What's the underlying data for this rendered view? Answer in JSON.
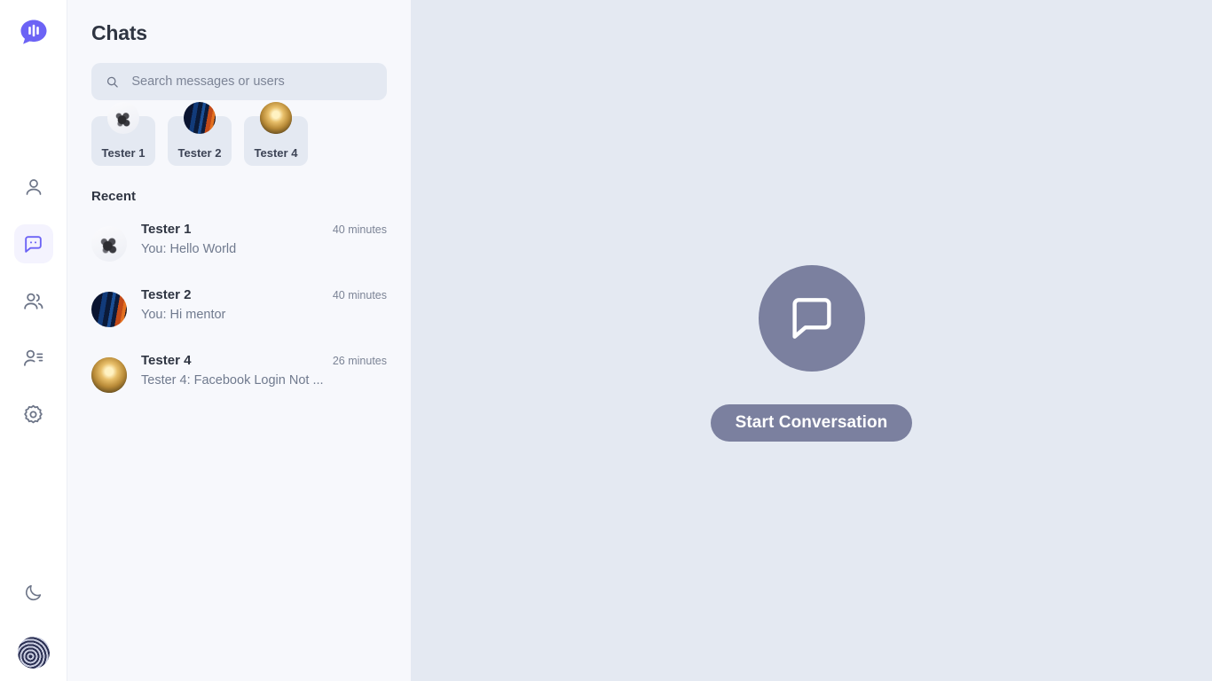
{
  "rail": {
    "logo": {
      "name": "app-logo",
      "icon": "chat-bubble-logo-icon",
      "color": "#6c63f5"
    },
    "items": [
      {
        "id": "profile",
        "icon": "user-icon",
        "active": false
      },
      {
        "id": "chats",
        "icon": "chat-bubble-icon",
        "active": true
      },
      {
        "id": "groups",
        "icon": "users-group-icon",
        "active": false
      },
      {
        "id": "contacts",
        "icon": "user-list-icon",
        "active": false
      },
      {
        "id": "settings",
        "icon": "gear-icon",
        "active": false
      }
    ],
    "theme_toggle": {
      "icon": "moon-icon"
    },
    "account_avatar": {
      "icon": "user-avatar",
      "art": "av-me"
    }
  },
  "panel": {
    "title": "Chats",
    "search": {
      "icon": "search-icon",
      "placeholder": "Search messages or users",
      "value": ""
    },
    "chips": [
      {
        "name": "Tester 1",
        "art": "av-t1"
      },
      {
        "name": "Tester 2",
        "art": "av-t2"
      },
      {
        "name": "Tester 4",
        "art": "av-t4"
      }
    ],
    "section_title": "Recent",
    "recent": [
      {
        "name": "Tester 1",
        "snippet": "You: Hello World",
        "time": "40 minutes",
        "art": "av-t1"
      },
      {
        "name": "Tester 2",
        "snippet": "You: Hi mentor",
        "time": "40 minutes",
        "art": "av-t2"
      },
      {
        "name": "Tester 4",
        "snippet": "Tester 4: Facebook Login Not ...",
        "time": "26 minutes",
        "art": "av-t4"
      }
    ]
  },
  "main": {
    "empty_icon": "chat-bubble-outline-icon",
    "start_label": "Start Conversation",
    "accent": "#7b809f",
    "background": "#e4e9f2"
  }
}
